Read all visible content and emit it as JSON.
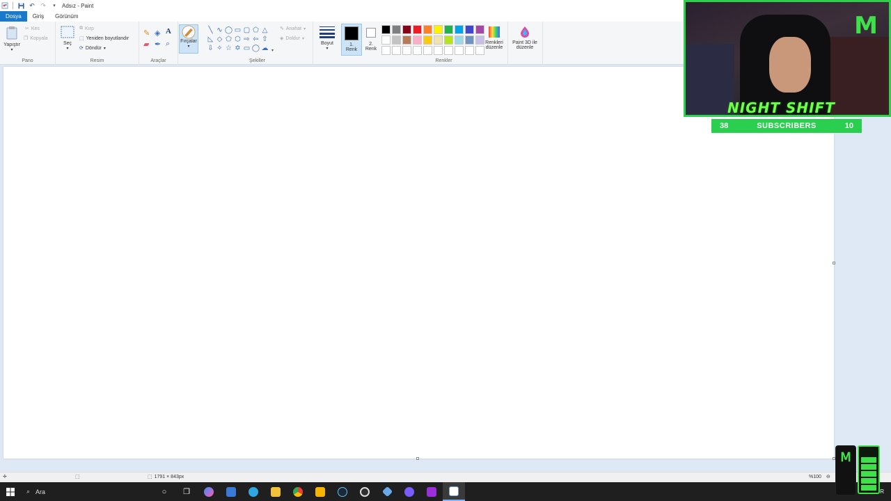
{
  "titlebar": {
    "title": "Adsız - Paint"
  },
  "tabs": [
    {
      "label": "Dosya"
    },
    {
      "label": "Giriş"
    },
    {
      "label": "Görünüm"
    }
  ],
  "ribbon": {
    "clipboard": {
      "group_label": "Pano",
      "paste": "Yapıştır",
      "cut": "Kes",
      "copy": "Kopyala"
    },
    "image": {
      "group_label": "Resim",
      "select": "Seç",
      "crop": "Kırp",
      "resize": "Yeniden boyutlandır",
      "rotate": "Döndür"
    },
    "tools": {
      "group_label": "Araçlar"
    },
    "brushes": {
      "label": "Fırçalar"
    },
    "shapes": {
      "group_label": "Şekiller",
      "outline": "Anahat",
      "fill": "Doldur"
    },
    "size": {
      "label": "Boyut"
    },
    "color1": {
      "line1": "1.",
      "line2": "Renk"
    },
    "color2": {
      "line1": "2.",
      "line2": "Renk"
    },
    "colors": {
      "group_label": "Renkler",
      "edit_line1": "Renkleri",
      "edit_line2": "düzenle",
      "palette": [
        "#000000",
        "#7f7f7f",
        "#880015",
        "#ed1c24",
        "#ff7f27",
        "#fff200",
        "#22b14c",
        "#00a2e8",
        "#3f48cc",
        "#a349a4",
        "#ffffff",
        "#c3c3c3",
        "#b97a57",
        "#ffaec9",
        "#ffc90e",
        "#efe4b0",
        "#b5e61d",
        "#99d9ea",
        "#7092be",
        "#c8bfe7",
        "#ffffff",
        "#ffffff",
        "#ffffff",
        "#ffffff",
        "#ffffff",
        "#ffffff",
        "#ffffff",
        "#ffffff",
        "#ffffff",
        "#ffffff"
      ]
    },
    "paint3d": {
      "line1": "Paint 3D ile",
      "line2": "düzenle"
    }
  },
  "statusbar": {
    "dimensions": "1791 × 843px",
    "zoom": "%100"
  },
  "taskbar": {
    "search_placeholder": "Ara",
    "language": "TUR"
  },
  "overlay": {
    "brand": "NIGHT SHIFT",
    "subs_left": "38",
    "subs_label": "SUBSCRIBERS",
    "subs_right": "10"
  }
}
